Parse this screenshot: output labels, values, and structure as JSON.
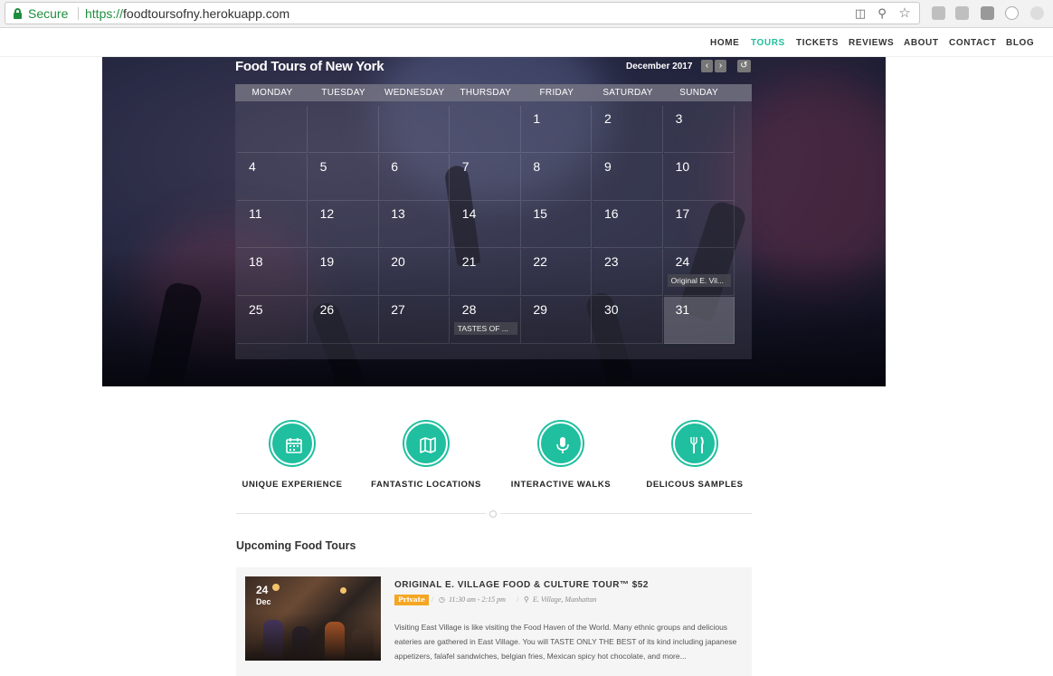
{
  "browser": {
    "secure_label": "Secure",
    "url_protocol": "https://",
    "url_host": "foodtoursofny.herokuapp.com"
  },
  "nav": {
    "items": [
      "HOME",
      "TOURS",
      "TICKETS",
      "REVIEWS",
      "ABOUT",
      "CONTACT",
      "BLOG"
    ],
    "active": "TOURS",
    "accent": "#1fbf9f"
  },
  "calendar": {
    "title": "Food Tours of New York",
    "month": "December 2017",
    "weekdays": [
      "MONDAY",
      "TUESDAY",
      "WEDNESDAY",
      "THURSDAY",
      "FRIDAY",
      "SATURDAY",
      "SUNDAY"
    ],
    "weeks": [
      [
        "",
        "",
        "",
        "",
        "1",
        "2",
        "3"
      ],
      [
        "4",
        "5",
        "6",
        "7",
        "8",
        "9",
        "10"
      ],
      [
        "11",
        "12",
        "13",
        "14",
        "15",
        "16",
        "17"
      ],
      [
        "18",
        "19",
        "20",
        "21",
        "22",
        "23",
        "24"
      ],
      [
        "25",
        "26",
        "27",
        "28",
        "29",
        "30",
        "31"
      ]
    ],
    "events": {
      "24": "Original E. Vil...",
      "28": "TASTES OF ..."
    },
    "today": "31"
  },
  "features": [
    {
      "label": "UNIQUE EXPERIENCE",
      "icon": "calendar-icon"
    },
    {
      "label": "FANTASTIC LOCATIONS",
      "icon": "map-icon"
    },
    {
      "label": "INTERACTIVE WALKS",
      "icon": "microphone-icon"
    },
    {
      "label": "DELICOUS SAMPLES",
      "icon": "utensils-icon"
    }
  ],
  "upcoming": {
    "heading": "Upcoming Food Tours",
    "tour": {
      "day": "24",
      "month": "Dec",
      "title": "ORIGINAL E. VILLAGE FOOD & CULTURE TOUR™ $52",
      "badge": "Private",
      "time": "11:30 am - 2:15 pm",
      "location": "E. Village, Manhattan",
      "description": "Visiting East Village is like visiting the Food Haven of the World. Many ethnic groups and delicious eateries are gathered in East Village. You will TASTE ONLY THE BEST of its kind including japanese appetizers, falafel sandwiches, belgian fries, Mexican spicy hot chocolate, and more..."
    }
  }
}
